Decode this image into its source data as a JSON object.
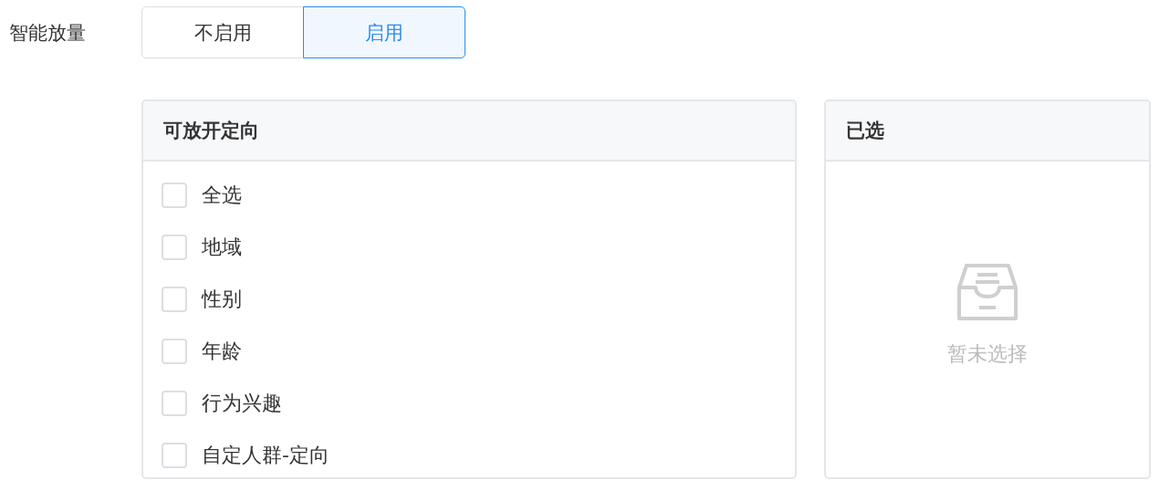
{
  "smart_release": {
    "label": "智能放量",
    "options": [
      {
        "label": "不启用",
        "selected": false
      },
      {
        "label": "启用",
        "selected": true
      }
    ]
  },
  "available_panel": {
    "title": "可放开定向",
    "items": [
      {
        "label": "全选",
        "checked": false
      },
      {
        "label": "地域",
        "checked": false
      },
      {
        "label": "性别",
        "checked": false
      },
      {
        "label": "年龄",
        "checked": false
      },
      {
        "label": "行为兴趣",
        "checked": false
      },
      {
        "label": "自定人群-定向",
        "checked": false
      }
    ]
  },
  "selected_panel": {
    "title": "已选",
    "empty_text": "暂未选择"
  }
}
